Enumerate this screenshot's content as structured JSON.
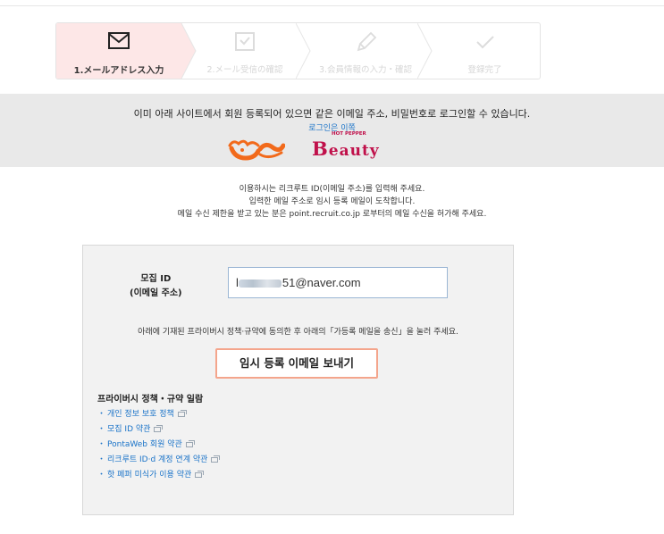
{
  "steps": [
    {
      "number": "1.",
      "label": "メールアドレス入力",
      "icon": "envelope-icon",
      "active": true
    },
    {
      "number": "2.",
      "label": "メール受信の確認",
      "icon": "envelope-check-icon",
      "active": false
    },
    {
      "number": "3.",
      "label": "会員情報の入力・確認",
      "icon": "pencil-icon",
      "active": false
    },
    {
      "number": "",
      "label": "登録完了",
      "icon": "checkmark-icon",
      "active": false
    }
  ],
  "notice": {
    "text": "이미 아래 사이트에서 회원 등록되어 있으면 같은 이메일 주소, 비밀번호로 로그인할 수 있습니다.",
    "link": "로그인은 이쪽",
    "logo_beauty_small": "HOT PEPPER",
    "logo_beauty_b": "B",
    "logo_beauty_rest": "eauty"
  },
  "instructions": [
    "이용하시는 리크루트 ID(이메일 주소)를 입력해 주세요.",
    "입력한 메일 주소로 임시 등록 메일이 도착합니다.",
    "메일 수신 제한을 받고 있는 분은 point.recruit.co.jp 로부터의 메일 수신을 허가해 주세요."
  ],
  "form": {
    "label_line1": "모집 ID",
    "label_line2": "(이메일 주소)",
    "email_prefix": "l",
    "email_suffix": "51@naver.com",
    "agree_text": "아래에 기재된 프라이버시 정책·규약에 동의한 후 아래의「가등록 메일을 송신」을 눌러 주세요.",
    "send_button": "임시 등록 이메일 보내기"
  },
  "policies": {
    "title": "프라이버시 정책・규약 일람",
    "items": [
      "개인 정보 보호 정책",
      "모집 ID 약관",
      "PontaWeb 회원 약관",
      "리크루트 ID·d 계정 연계 약관",
      "핫 페퍼 미식가 이용 약관"
    ]
  },
  "colors": {
    "active_step_bg": "#fde7e7",
    "link": "#1a73c8",
    "button_border": "#f4a58c",
    "band_bg": "#e9e9e9",
    "beauty_brand": "#c0104a",
    "ponta_orange": "#f26a1b"
  }
}
